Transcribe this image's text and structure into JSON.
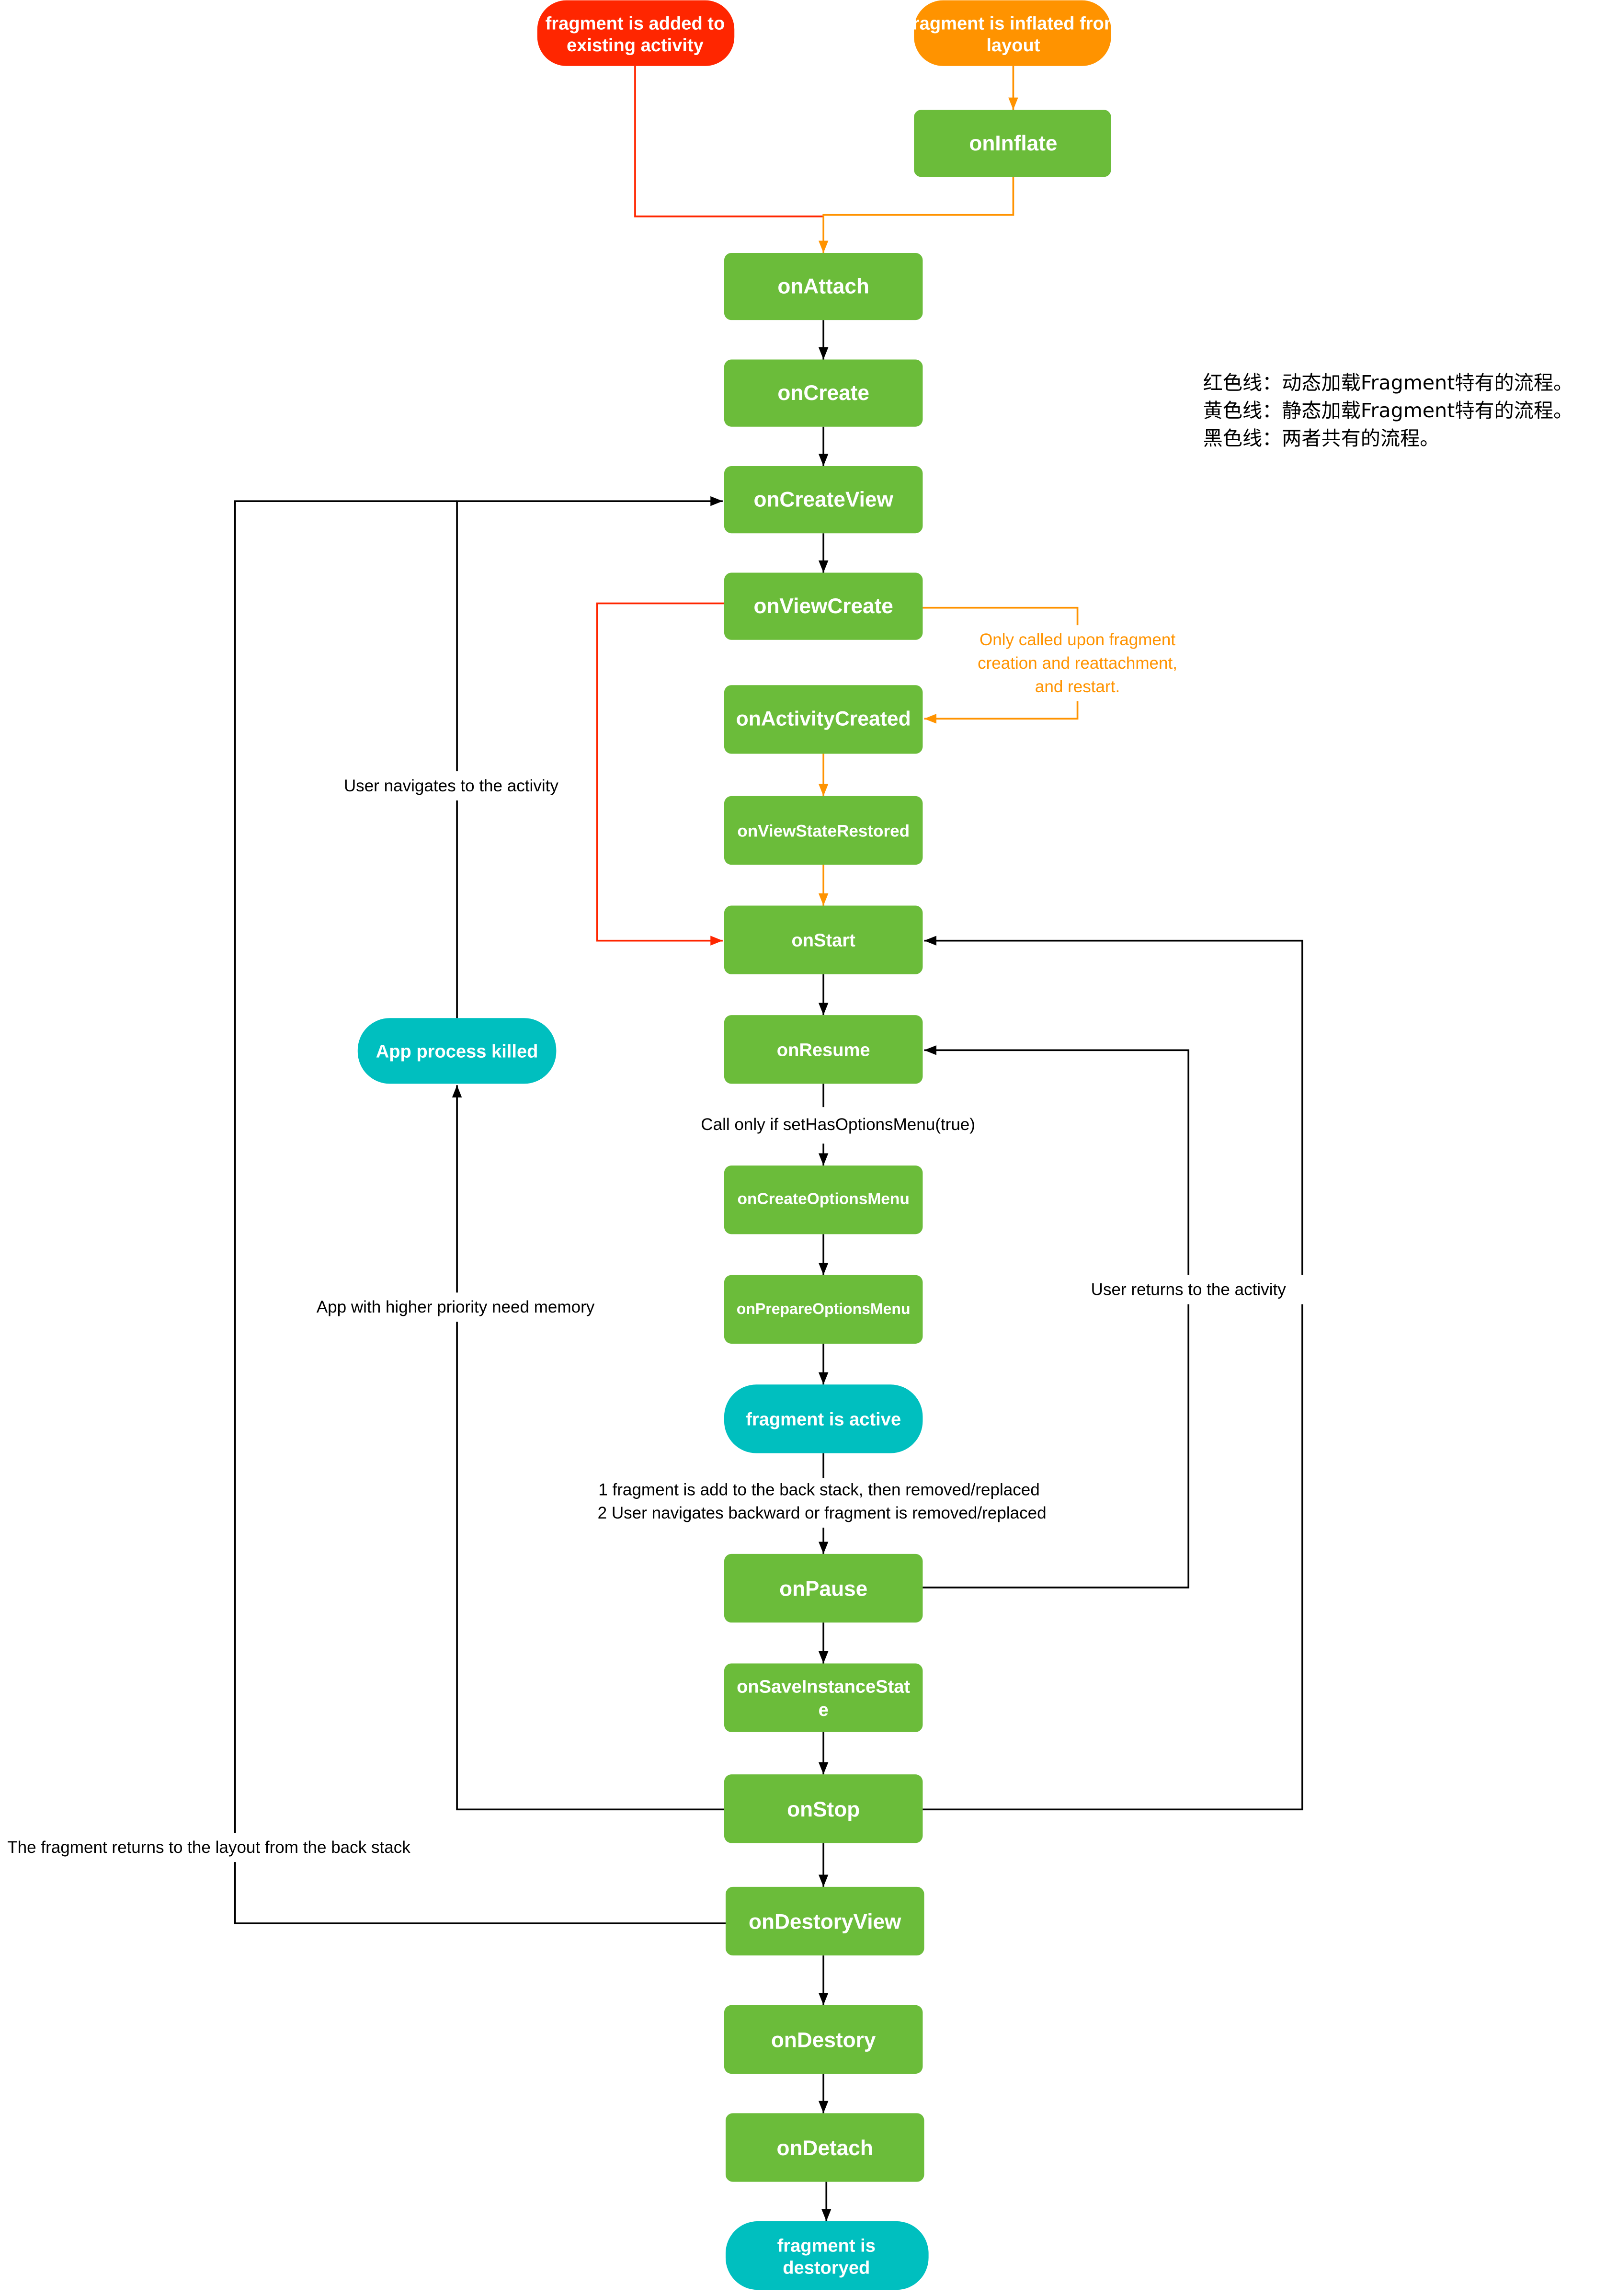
{
  "colors": {
    "process_node": "#6BBC3A",
    "state_node": "#00BFBF",
    "dynamic_start": "#FF2600",
    "static_start": "#FF9300",
    "common_line": "#000000",
    "text_on_node": "#FFFFFF"
  },
  "start_nodes": {
    "dynamic": "fragment is added to existing activity",
    "static": "fragment is inflated from layout"
  },
  "nodes": {
    "onInflate": "onInflate",
    "onAttach": "onAttach",
    "onCreate": "onCreate",
    "onCreateView": "onCreateView",
    "onViewCreate": "onViewCreate",
    "onActivityCreated": "onActivityCreated",
    "onViewStateRestored": "onViewStateRestored",
    "onStart": "onStart",
    "onResume": "onResume",
    "onCreateOptionsMenu": "onCreateOptionsMenu",
    "onPrepareOptionsMenu": "onPrepareOptionsMenu",
    "fragmentActive": "fragment is active",
    "onPause": "onPause",
    "onSaveInstanceState": "onSaveInstanceState",
    "onStop": "onStop",
    "onDestoryView": "onDestoryView",
    "onDestory": "onDestory",
    "onDetach": "onDetach",
    "fragmentDestroyed": "fragment is destoryed",
    "appProcessKilled": "App process killed"
  },
  "labels": {
    "onlyCalledUpon": [
      "Only called upon fragment",
      "creation and reattachment,",
      "and restart."
    ],
    "userNavigatesToActivity": "User navigates to the activity",
    "callOnlyIf": "Call only if setHasOptionsMenu(true)",
    "appHigherPriority": "App with higher priority need memory",
    "userReturnsToActivity": "User returns to the activity",
    "backStackLine1": "1 fragment is add to the back stack, then removed/replaced",
    "backStackLine2": "2 User navigates backward or fragment is removed/replaced",
    "fragmentReturns": "The fragment returns to the layout from the back stack"
  },
  "legend": [
    "红色线：动态加载Fragment特有的流程。",
    "黄色线：静态加载Fragment特有的流程。",
    "黑色线：两者共有的流程。"
  ]
}
